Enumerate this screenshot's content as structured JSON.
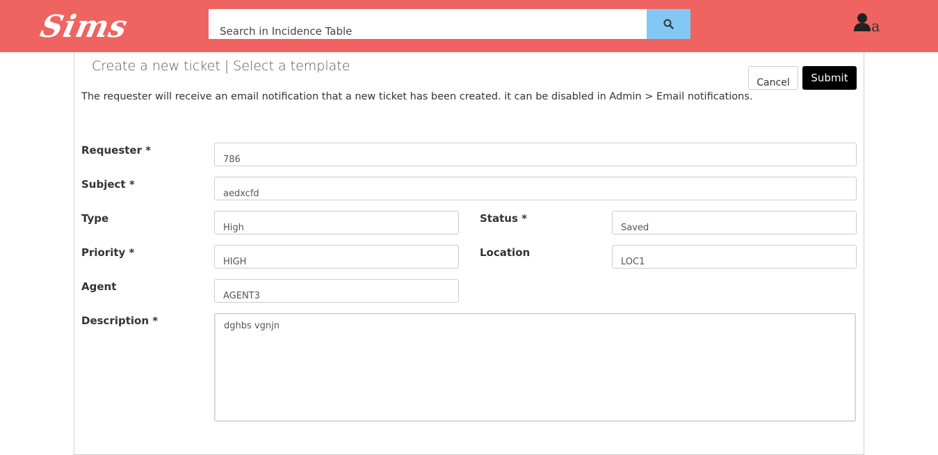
{
  "header": {
    "logo_text": "Sims",
    "search": {
      "placeholder": "Search in Incidence Table",
      "button_icon": "search-icon"
    },
    "user": {
      "icon": "user-icon",
      "label": "a"
    }
  },
  "page": {
    "title": "Create a new ticket | Select a template",
    "notice": "The requester will receive an email notification that a new ticket has been created. it can be disabled in Admin > Email notifications."
  },
  "actions": {
    "cancel_label": "Cancel",
    "submit_label": "Submit"
  },
  "form": {
    "requester": {
      "label": "Requester *",
      "value": "786"
    },
    "subject": {
      "label": "Subject *",
      "value": "aedxcfd"
    },
    "type": {
      "label": "Type",
      "value": "High"
    },
    "status": {
      "label": "Status *",
      "value": "Saved"
    },
    "priority": {
      "label": "Priority *",
      "value": "HIGH"
    },
    "location": {
      "label": "Location",
      "value": "LOC1"
    },
    "agent": {
      "label": "Agent",
      "value": "AGENT3"
    },
    "description": {
      "label": "Description *",
      "value": "dghbs vgnjn"
    }
  },
  "colors": {
    "header_bg": "#ef6461",
    "search_button_bg": "#82c8f5",
    "submit_bg": "#000000"
  }
}
